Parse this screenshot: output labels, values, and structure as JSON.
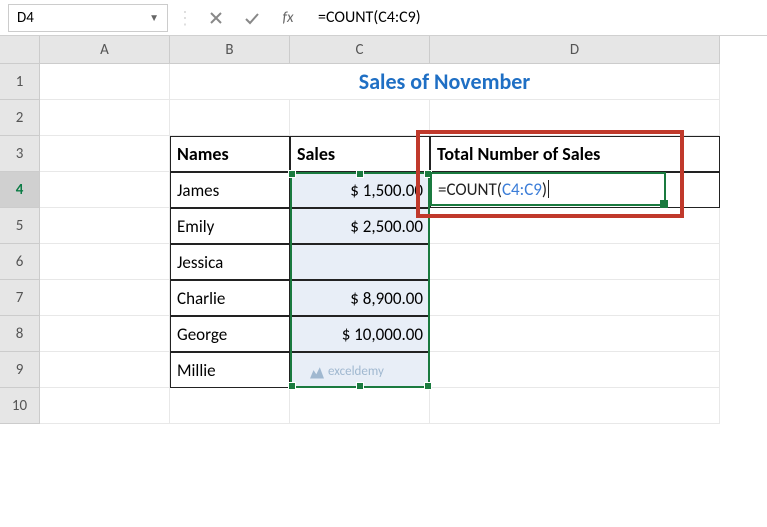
{
  "name_box": "D4",
  "formula_bar": "=COUNT(C4:C9)",
  "columns": [
    "A",
    "B",
    "C",
    "D"
  ],
  "rows": [
    "1",
    "2",
    "3",
    "4",
    "5",
    "6",
    "7",
    "8",
    "9",
    "10"
  ],
  "title": "Sales of November",
  "headers": {
    "names": "Names",
    "sales": "Sales",
    "total": "Total Number of Sales"
  },
  "data": [
    {
      "name": "James",
      "sales": "$  1,500.00"
    },
    {
      "name": "Emily",
      "sales": "$  2,500.00"
    },
    {
      "name": "Jessica",
      "sales": ""
    },
    {
      "name": "Charlie",
      "sales": "$  8,900.00"
    },
    {
      "name": "George",
      "sales": "$ 10,000.00"
    },
    {
      "name": "Millie",
      "sales": ""
    }
  ],
  "active_formula": {
    "prefix": "=COUNT(",
    "ref": "C4:C9",
    "suffix": ")"
  },
  "watermark": "exceldemy"
}
